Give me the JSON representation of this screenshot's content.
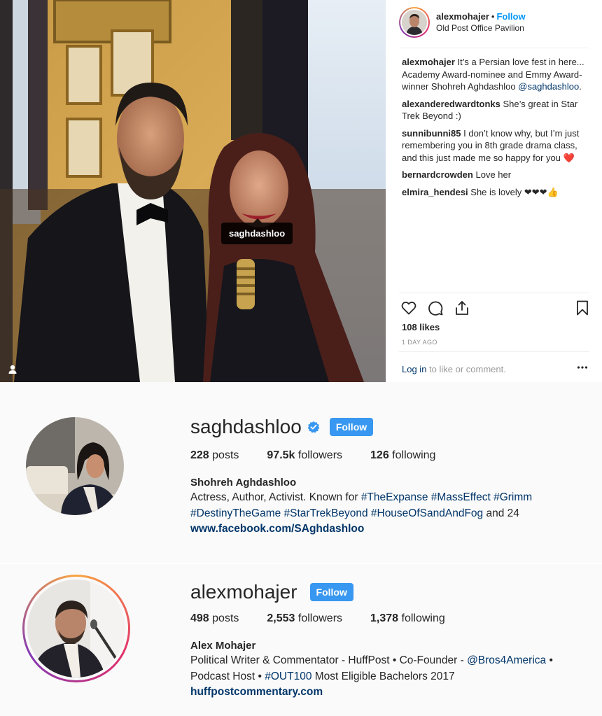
{
  "post": {
    "photo_tag": "saghdashloo",
    "header": {
      "username": "alexmohajer",
      "separator": "•",
      "follow_label": "Follow",
      "location": "Old Post Office Pavilion"
    },
    "caption": {
      "username": "alexmohajer",
      "text": "It’s a Persian love fest in here... Academy Award-nominee and Emmy Award-winner Shohreh Aghdashloo",
      "mention": "@saghdashloo",
      "end": "."
    },
    "comments": [
      {
        "username": "alexanderedwardtonks",
        "text": "She’s great in Star Trek Beyond :)"
      },
      {
        "username": "sunnibunni85",
        "text": "I don’t know why, but I’m just remembering you in 8th grade drama class, and this just made me so happy for you ❤️"
      },
      {
        "username": "bernardcrowden",
        "text": "Love her"
      },
      {
        "username": "elmira_hendesi",
        "text": "She is lovely ❤❤❤👍"
      }
    ],
    "likes": "108 likes",
    "time": "1 DAY AGO",
    "login_link": "Log in",
    "login_rest": " to like or comment."
  },
  "profiles": [
    {
      "username": "saghdashloo",
      "verified": true,
      "follow_label": "Follow",
      "posts_count": "228",
      "posts_label": " posts",
      "followers_count": "97.5k",
      "followers_label": " followers",
      "following_count": "126",
      "following_label": " following",
      "full_name": "Shohreh Aghdashloo",
      "bio_prefix": "Actress, Author, Activist. Known for ",
      "hashtags_line1": "#TheExpanse #MassEffect #Grimm",
      "hashtags_line2": "#DestinyTheGame #StarTrekBeyond #HouseOfSandAndFog",
      "bio_suffix": " and 24",
      "website": "www.facebook.com/SAghdashloo"
    },
    {
      "username": "alexmohajer",
      "verified": false,
      "follow_label": "Follow",
      "posts_count": "498",
      "posts_label": " posts",
      "followers_count": "2,553",
      "followers_label": " followers",
      "following_count": "1,378",
      "following_label": " following",
      "full_name": "Alex Mohajer",
      "bio_line1_prefix": "Political Writer & Commentator - HuffPost • Co-Founder - ",
      "bio_line1_mention": "@Bros4America",
      "bio_line1_suffix": " •",
      "bio_line2_prefix": "Podcast Host • ",
      "bio_line2_hashtag": "#OUT100",
      "bio_line2_suffix": " Most Eligible Bachelors 2017",
      "website": "huffpostcommentary.com"
    }
  ],
  "colors": {
    "link_blue": "#003569",
    "follow_blue": "#0095f6",
    "button_blue": "#3897f0",
    "heart_red": "#ed4956"
  },
  "icons": [
    "user-tag-icon",
    "heart-icon",
    "comment-icon",
    "share-icon",
    "bookmark-icon",
    "more-options-icon",
    "verified-badge-icon"
  ]
}
